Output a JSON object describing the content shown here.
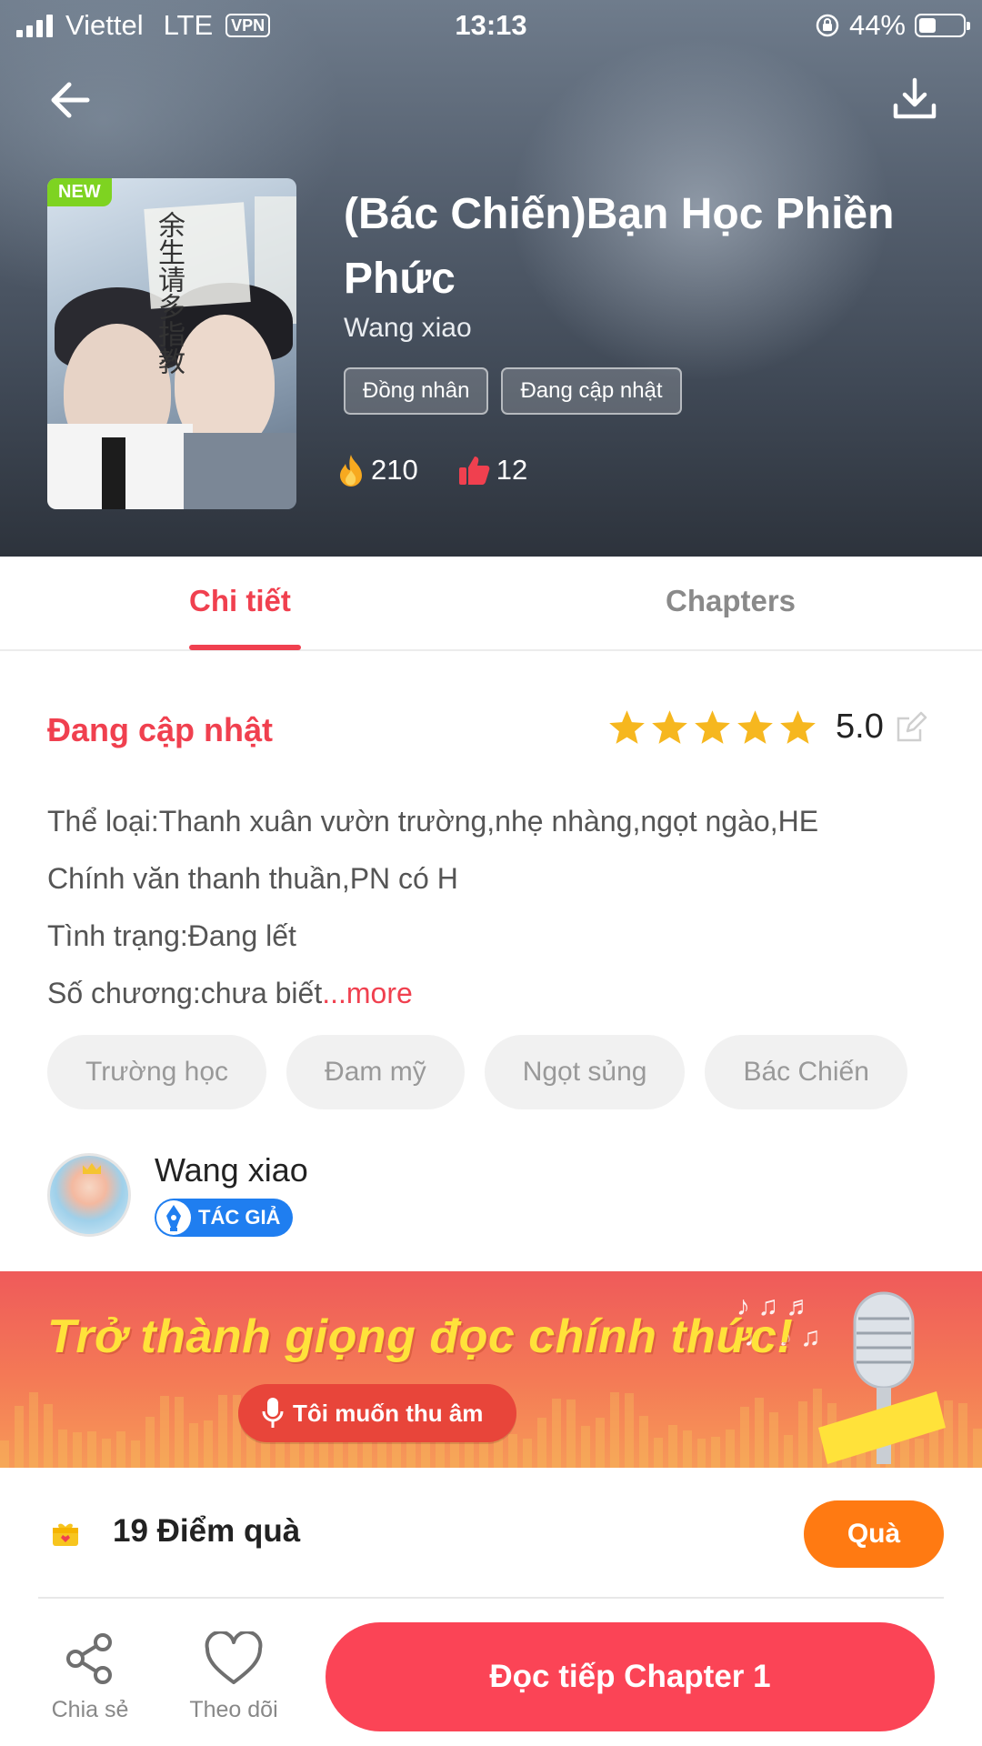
{
  "status_bar": {
    "carrier": "Viettel",
    "network": "LTE",
    "vpn": "VPN",
    "time": "13:13",
    "battery": "44%"
  },
  "header": {
    "back_icon": "arrow-left-icon",
    "download_icon": "download-icon",
    "cover_badge": "NEW",
    "cover_title_text": "余生请多指教",
    "title": "(Bác Chiến)Bạn Học Phiền Phức",
    "author": "Wang xiao",
    "tags": [
      "Đồng nhân",
      "Đang cập nhật"
    ],
    "views": "210",
    "likes": "12"
  },
  "tabs": [
    {
      "label": "Chi tiết",
      "active": true
    },
    {
      "label": "Chapters",
      "active": false
    }
  ],
  "details": {
    "status": "Đang cập nhật",
    "rating": "5.0",
    "stars": 5,
    "description_lines": [
      "Thể loại:Thanh xuân vườn trường,nhẹ nhàng,ngọt ngào,HE",
      "Chính văn thanh thuần,PN có H",
      "Tình trạng:Đang lết",
      "Số chương:chưa biết"
    ],
    "more_label": "...more",
    "genres": [
      "Trường học",
      "Đam mỹ",
      "Ngọt sủng",
      "Bác Chiến"
    ]
  },
  "author_block": {
    "name": "Wang xiao",
    "badge": "TÁC GIẢ"
  },
  "banner": {
    "title": "Trở thành giọng đọc chính thức!",
    "button": "Tôi muốn thu âm"
  },
  "gift": {
    "text": "19 Điểm quà",
    "button": "Quà"
  },
  "bottom_bar": {
    "share_label": "Chia sẻ",
    "follow_label": "Theo dõi",
    "read_button": "Đọc tiếp Chapter 1"
  },
  "colors": {
    "accent": "#f0404f",
    "read_button": "#fb4456",
    "gift_button": "#ff7a12",
    "author_badge": "#1f7ef0",
    "star": "#f6b71f"
  }
}
